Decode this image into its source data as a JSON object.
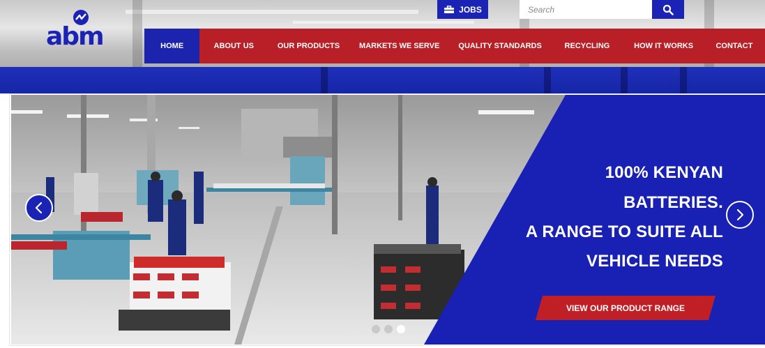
{
  "header": {
    "jobs_label": "JOBS",
    "search": {
      "placeholder": "Search"
    }
  },
  "nav": {
    "items": [
      {
        "label": "HOME",
        "active": true
      },
      {
        "label": "ABOUT US"
      },
      {
        "label": "OUR PRODUCTS"
      },
      {
        "label": "MARKETS WE SERVE"
      },
      {
        "label": "QUALITY STANDARDS"
      },
      {
        "label": "RECYCLING"
      },
      {
        "label": "HOW IT WORKS"
      },
      {
        "label": "CONTACT"
      }
    ]
  },
  "slider": {
    "headline": [
      "100% KENYAN",
      "BATTERIES.",
      "A RANGE TO SUITE ALL",
      "VEHICLE NEEDS"
    ],
    "cta_label": "VIEW OUR PRODUCT RANGE",
    "dots_total": 3,
    "active_dot": 3
  },
  "colors": {
    "brand_blue": "#1a23b4",
    "brand_red": "#b81f27",
    "nav_active": "#1c24ae"
  },
  "icons": {
    "jobs": "briefcase-icon",
    "search": "search-icon",
    "prev": "chevron-left-icon",
    "next": "chevron-right-icon"
  }
}
